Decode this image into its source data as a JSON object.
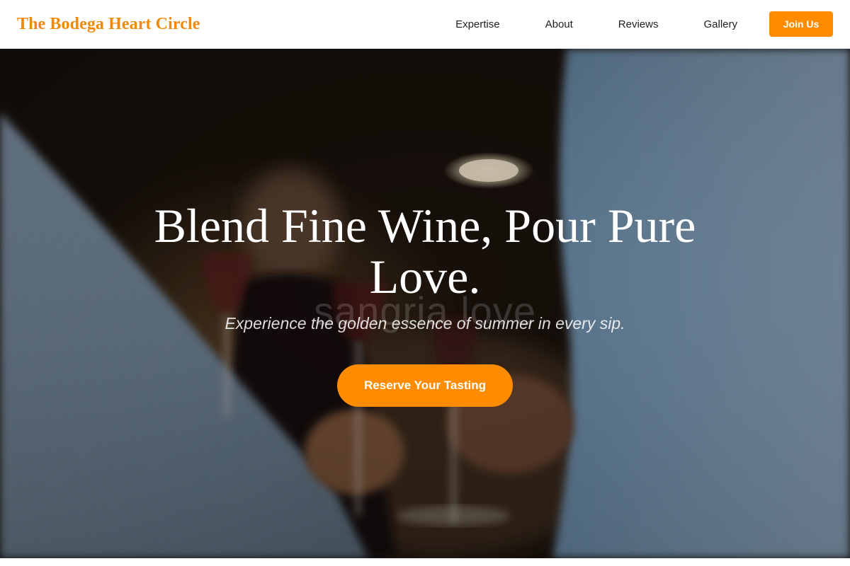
{
  "nav": {
    "brand": "The Bodega Heart Circle",
    "links": [
      "Expertise",
      "About",
      "Reviews",
      "Gallery"
    ],
    "cta": "Join Us"
  },
  "hero": {
    "watermark": "sangria love",
    "title": "Blend Fine Wine, Pour Pure Love.",
    "subtitle": "Experience the golden essence of summer in every sip.",
    "cta": "Reserve Your Tasting",
    "image": "wine-toast-photo"
  },
  "colors": {
    "accent": "#ff8c00",
    "brand": "#f08a0c",
    "nav_text": "#1f1f1f",
    "background": "#ffffff"
  }
}
